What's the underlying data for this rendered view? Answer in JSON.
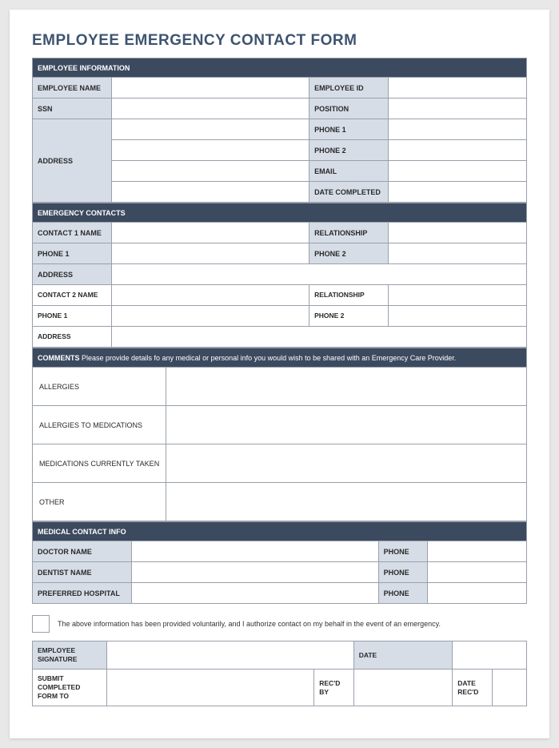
{
  "title": "EMPLOYEE EMERGENCY CONTACT FORM",
  "employee_info": {
    "section": "EMPLOYEE INFORMATION",
    "name_label": "EMPLOYEE NAME",
    "id_label": "EMPLOYEE ID",
    "ssn_label": "SSN",
    "position_label": "POSITION",
    "address_label": "ADDRESS",
    "phone1_label": "PHONE 1",
    "phone2_label": "PHONE 2",
    "email_label": "EMAIL",
    "date_completed_label": "DATE COMPLETED"
  },
  "emergency": {
    "section": "EMERGENCY CONTACTS",
    "c1_name_label": "CONTACT 1 NAME",
    "relationship_label": "RELATIONSHIP",
    "phone1_label": "PHONE 1",
    "phone2_label": "PHONE 2",
    "address_label": "ADDRESS",
    "c2_name_label": "CONTACT 2 NAME"
  },
  "comments": {
    "section_strong": "COMMENTS",
    "section_rest": " Please provide details fo any medical or personal info you would wish to be shared with an Emergency Care Provider.",
    "allergies": "ALLERGIES",
    "allergies_meds": "ALLERGIES TO MEDICATIONS",
    "meds_current": "MEDICATIONS CURRENTLY TAKEN",
    "other": "OTHER"
  },
  "medical": {
    "section": "MEDICAL CONTACT INFO",
    "doctor_label": "DOCTOR NAME",
    "dentist_label": "DENTIST NAME",
    "hospital_label": "PREFERRED HOSPITAL",
    "phone_label": "PHONE"
  },
  "consent": {
    "text": "The above information has been provided voluntarily, and I authorize contact on my behalf in the event of an emergency."
  },
  "signature": {
    "sig_label": "EMPLOYEE SIGNATURE",
    "date_label": "DATE",
    "submit_label": "SUBMIT COMPLETED FORM TO",
    "recd_by_label": "REC'D BY",
    "date_recd_label": "DATE REC'D"
  }
}
